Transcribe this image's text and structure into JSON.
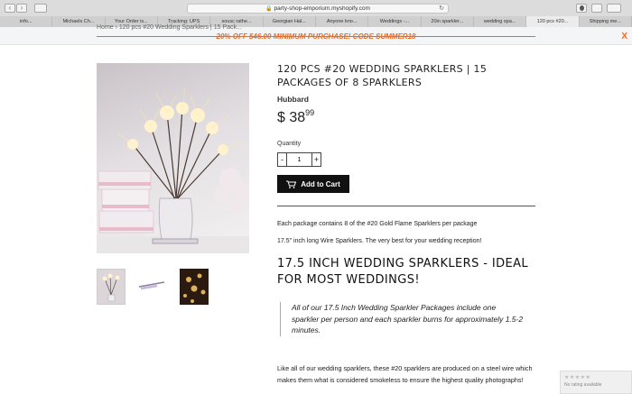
{
  "browser": {
    "url": "party-shop-emporium.myshopify.com",
    "tabs": [
      {
        "label": "info..."
      },
      {
        "label": "Michaels Ch..."
      },
      {
        "label": "Your Order is..."
      },
      {
        "label": "Tracking: UPS"
      },
      {
        "label": "sousc rathe..."
      },
      {
        "label": "Georgian Hal..."
      },
      {
        "label": "Anyone kno..."
      },
      {
        "label": "Weddings -..."
      },
      {
        "label": "20in sparkler..."
      },
      {
        "label": "wedding spa..."
      },
      {
        "label": "120 pcs #20..."
      },
      {
        "label": "Shipping me..."
      }
    ],
    "active_tab_index": 10
  },
  "promo": {
    "breadcrumb": "Home  ›  120 pcs #20 Wedding Sparklers | 15 Pack...",
    "text": "20% OFF $46.00 MINIMUM PURCHASE! CODE SUMMER18",
    "close": "X",
    "color": "#f26a21"
  },
  "product": {
    "title": "120 PCS #20 WEDDING SPARKLERS | 15 PACKAGES OF 8 SPARKLERS",
    "vendor": "Hubbard",
    "price_currency": "$ ",
    "price_whole": "38",
    "price_cents": "99",
    "quantity_label": "Quantity",
    "quantity_value": "1",
    "minus": "-",
    "plus": "+",
    "add_to_cart": "Add to Cart",
    "desc1": "Each package contains 8 of the #20 Gold Flame Sparklers per package",
    "desc2": "17.5\" inch long Wire Sparklers. The very best for your wedding reception!",
    "heading": "17.5 INCH WEDDING SPARKLERS - IDEAL FOR MOST WEDDINGS!",
    "quote": "All of our 17.5 Inch Wedding Sparkler Packages include one sparkler per person and each sparkler burns for approximately 1.5-2 minutes.",
    "desc3": "Like all of our wedding sparklers, these #20 sparklers are produced on a steel wire which makes them what is considered smokeless to ensure the highest quality photographs!"
  },
  "rating_widget": {
    "stars": "★★★★★",
    "text": "No rating available"
  },
  "icons": {
    "cart": "cart-icon",
    "lock": "lock-icon",
    "reload": "reload-icon"
  }
}
